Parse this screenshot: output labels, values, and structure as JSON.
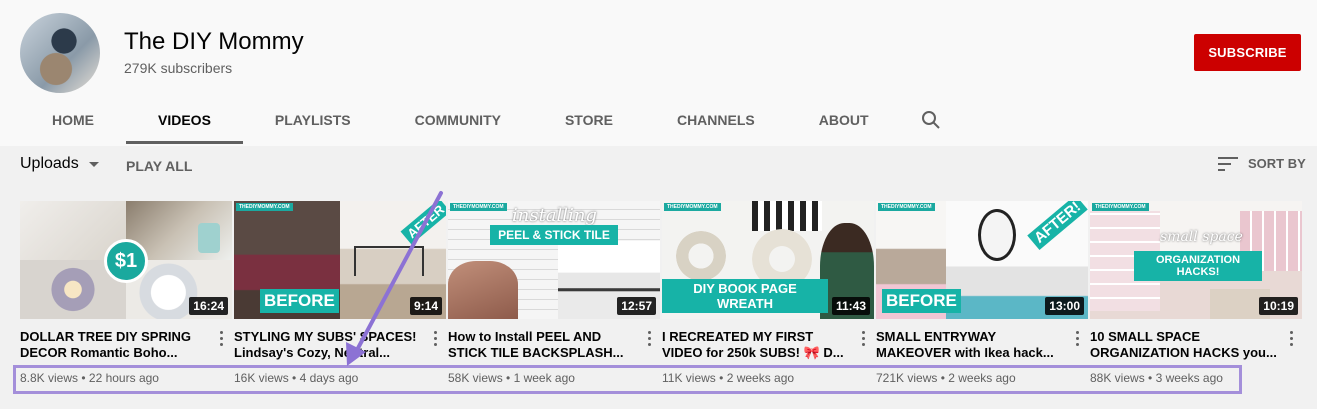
{
  "channel": {
    "name": "The DIY Mommy",
    "subscribers": "279K subscribers",
    "subscribe_label": "SUBSCRIBE"
  },
  "tabs": [
    {
      "label": "HOME",
      "active": false
    },
    {
      "label": "VIDEOS",
      "active": true
    },
    {
      "label": "PLAYLISTS",
      "active": false
    },
    {
      "label": "COMMUNITY",
      "active": false
    },
    {
      "label": "STORE",
      "active": false
    },
    {
      "label": "CHANNELS",
      "active": false
    },
    {
      "label": "ABOUT",
      "active": false
    }
  ],
  "toolbar": {
    "uploads_label": "Uploads",
    "play_all_label": "PLAY ALL",
    "sort_by_label": "SORT BY"
  },
  "videos": [
    {
      "title_line1": "DOLLAR TREE DIY SPRING",
      "title_line2": "DECOR Romantic Boho...",
      "duration": "16:24",
      "views": "8.8K views",
      "age": "22 hours ago",
      "overlay": "$1"
    },
    {
      "title_line1": "STYLING MY SUBS' SPACES!",
      "title_line2": "Lindsay's Cozy, Neutral...",
      "duration": "9:14",
      "views": "16K views",
      "age": "4 days ago",
      "before": "BEFORE",
      "after": "AFTER"
    },
    {
      "title_line1": "How to Install PEEL AND",
      "title_line2": "STICK TILE BACKSPLASH...",
      "duration": "12:57",
      "views": "58K views",
      "age": "1 week ago",
      "script": "installing",
      "banner": "PEEL & STICK TILE"
    },
    {
      "title_line1": "I RECREATED MY FIRST",
      "title_line2": "VIDEO for 250k SUBS! 🎀 D...",
      "duration": "11:43",
      "views": "11K views",
      "age": "2 weeks ago",
      "banner": "DIY BOOK PAGE WREATH"
    },
    {
      "title_line1": "SMALL ENTRYWAY",
      "title_line2": "MAKEOVER with Ikea hack...",
      "duration": "13:00",
      "views": "721K views",
      "age": "2 weeks ago",
      "before": "BEFORE",
      "after": "AFTER!"
    },
    {
      "title_line1": "10 SMALL SPACE",
      "title_line2": "ORGANIZATION HACKS you...",
      "duration": "10:19",
      "views": "88K views",
      "age": "3 weeks ago",
      "script": "small space",
      "banner": "ORGANIZATION HACKS!"
    }
  ],
  "thumb_brand": "THEDIYMOMMY.COM",
  "meta_separator": " • ",
  "icons": {
    "search": "search-icon",
    "sort": "sort-icon",
    "more": "more-vert-icon",
    "caret": "caret-down-icon"
  },
  "colors": {
    "subscribe_bg": "#cc0000",
    "teal": "#17b3a7",
    "highlight": "#a48fda",
    "arrow": "#8c72d4"
  }
}
